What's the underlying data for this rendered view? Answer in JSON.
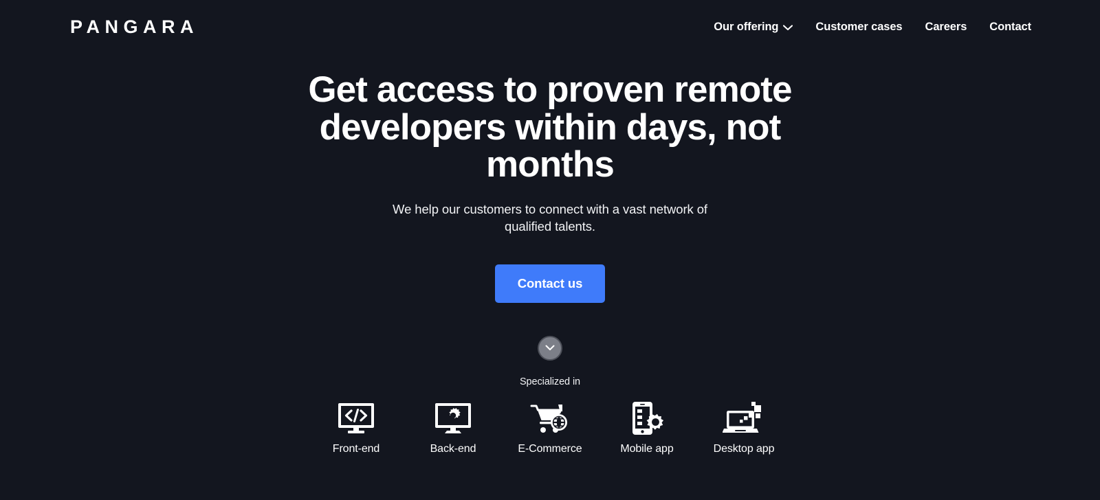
{
  "theme": {
    "background": "#13161F",
    "text": "#FFFFFF",
    "accent": "#3F7BFA",
    "muted": "#7C7F88"
  },
  "header": {
    "logo": "PANGARA",
    "nav": [
      {
        "label": "Our offering",
        "icon": "chevron-down-icon",
        "has_chevron": true
      },
      {
        "label": "Customer cases",
        "has_chevron": false
      },
      {
        "label": "Careers",
        "has_chevron": false
      },
      {
        "label": "Contact",
        "has_chevron": false
      }
    ]
  },
  "hero": {
    "headline": "Get access to proven remote developers within days, not months",
    "subheadline": "We help our customers to connect with a vast network of qualified talents.",
    "cta_label": "Contact us",
    "scroll_icon": "chevron-down-icon"
  },
  "specialized": {
    "label": "Specialized in",
    "items": [
      {
        "label": "Front-end",
        "icon": "monitor-code-icon"
      },
      {
        "label": "Back-end",
        "icon": "monitor-gear-icon"
      },
      {
        "label": "E-Commerce",
        "icon": "cart-globe-icon"
      },
      {
        "label": "Mobile app",
        "icon": "phone-gear-icon"
      },
      {
        "label": "Desktop app",
        "icon": "laptop-pixels-icon"
      }
    ]
  }
}
